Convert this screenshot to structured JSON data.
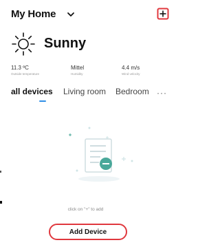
{
  "header": {
    "home_name": "My Home",
    "home_switch_icon": "chevron-down-icon",
    "add_icon": "plus-square-icon"
  },
  "weather": {
    "icon": "sun-icon",
    "condition": "Sunny",
    "stats": [
      {
        "value": "11.3 ºC",
        "label": "Outside temperature"
      },
      {
        "value": "Mittel",
        "label": "Humidity"
      },
      {
        "value": "4.4 m/s",
        "label": "Wind velocity"
      }
    ]
  },
  "tabs": [
    {
      "label": "all devices",
      "active": true
    },
    {
      "label": "Living room",
      "active": false
    },
    {
      "label": "Bedroom",
      "active": false
    }
  ],
  "tabs_more_label": "···",
  "empty_state": {
    "illustration": "empty-document-icon",
    "hint": "click on \"+\" to add",
    "button_label": "Add Device"
  },
  "colors": {
    "accent": "#2f8ee6",
    "highlight": "#e0373d",
    "illustration_teal": "#4aa89a",
    "illustration_light": "#cfe4e6"
  }
}
